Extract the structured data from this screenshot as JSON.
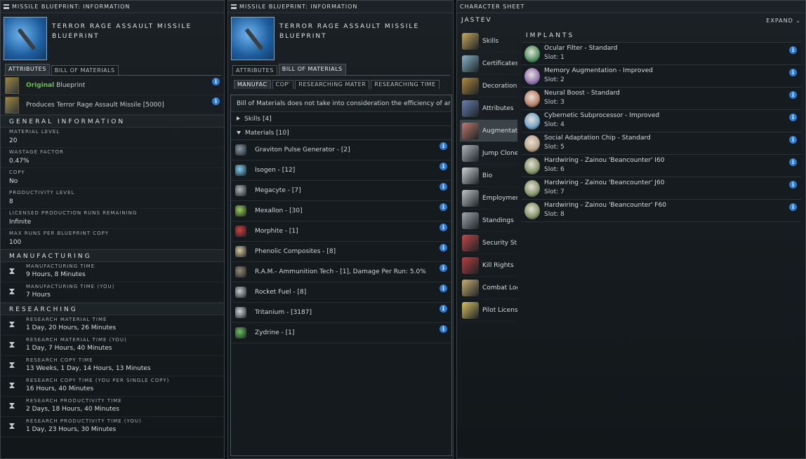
{
  "blueprint_windows": [
    {
      "title": "MISSILE BLUEPRINT: INFORMATION",
      "item_name": "TERROR RAGE ASSAULT MISSILE BLUEPRINT",
      "tabs": [
        "ATTRIBUTES",
        "BILL OF MATERIALS"
      ]
    }
  ],
  "attributes": {
    "original_label": "Original",
    "blueprint_label": "Blueprint",
    "produces": "Produces Terror Rage Assault Missile [5000]",
    "general_header": "GENERAL INFORMATION",
    "general": [
      {
        "k": "MATERIAL LEVEL",
        "v": "20"
      },
      {
        "k": "WASTAGE FACTOR",
        "v": "0.47%"
      },
      {
        "k": "COPY",
        "v": "No"
      },
      {
        "k": "PRODUCTIVITY LEVEL",
        "v": "8"
      },
      {
        "k": "LICENSED PRODUCTION RUNS REMAINING",
        "v": "Infinite"
      },
      {
        "k": "MAX RUNS PER BLUEPRINT COPY",
        "v": "100"
      }
    ],
    "manufacturing_header": "MANUFACTURING",
    "manufacturing": [
      {
        "k": "MANUFACTURING TIME",
        "v": "9 Hours, 8 Minutes"
      },
      {
        "k": "MANUFACTURING TIME (YOU)",
        "v": "7 Hours"
      }
    ],
    "researching_header": "RESEARCHING",
    "researching": [
      {
        "k": "RESEARCH MATERIAL TIME",
        "v": "1 Day, 20 Hours, 26 Minutes"
      },
      {
        "k": "RESEARCH MATERIAL TIME (YOU)",
        "v": "1 Day, 7 Hours, 40 Minutes"
      },
      {
        "k": "RESEARCH COPY TIME",
        "v": "13 Weeks, 1 Day, 14 Hours, 13 Minutes"
      },
      {
        "k": "RESEARCH COPY TIME (YOU PER SINGLE COPY)",
        "v": "16 Hours, 40 Minutes"
      },
      {
        "k": "RESEARCH PRODUCTIVITY TIME",
        "v": "2 Days, 18 Hours, 40 Minutes"
      },
      {
        "k": "RESEARCH PRODUCTIVITY TIME (YOU)",
        "v": "1 Day, 23 Hours, 30 Minutes"
      }
    ]
  },
  "bom": {
    "subtabs": [
      "MANUFAC",
      "COP'",
      "RESEARCHING MATER",
      "RESEARCHING TIME"
    ],
    "notice": "Bill of Materials does not take into consideration the efficiency of ar",
    "skills_label": "Skills [4]",
    "materials_label": "Materials [10]",
    "materials": [
      {
        "name": "Graviton Pulse Generator - [2]",
        "color": "#8a9aa8"
      },
      {
        "name": "Isogen - [12]",
        "color": "#7fd0f0"
      },
      {
        "name": "Megacyte - [7]",
        "color": "#b0b4b8"
      },
      {
        "name": "Mexallon - [30]",
        "color": "#9ccf5a"
      },
      {
        "name": "Morphite - [1]",
        "color": "#d04040"
      },
      {
        "name": "Phenolic Composites - [8]",
        "color": "#d8c8a0"
      },
      {
        "name": "R.A.M.- Ammunition Tech - [1], Damage Per Run: 5.0%",
        "color": "#9a8a78"
      },
      {
        "name": "Rocket Fuel - [8]",
        "color": "#c8ccd0"
      },
      {
        "name": "Tritanium - [3187]",
        "color": "#d0d4d8"
      },
      {
        "name": "Zydrine - [1]",
        "color": "#6cc060"
      }
    ]
  },
  "character": {
    "title": "CHARACTER SHEET",
    "pilot": "JASTEV",
    "expand": "EXPAND",
    "nav": [
      {
        "label": "Skills",
        "color": "#c8a860",
        "icon": "skills-icon"
      },
      {
        "label": "Certificates",
        "color": "#8ab4c8",
        "icon": "certificates-icon"
      },
      {
        "label": "Decorations",
        "color": "#b08a40",
        "icon": "decorations-icon"
      },
      {
        "label": "Attributes",
        "color": "#6a80b0",
        "icon": "attributes-icon"
      },
      {
        "label": "Augmentatio",
        "color": "#c07a70",
        "icon": "augmentations-icon"
      },
      {
        "label": "Jump Clone",
        "color": "#b0b8c0",
        "icon": "jump-clone-icon"
      },
      {
        "label": "Bio",
        "color": "#d0d4d8",
        "icon": "bio-icon"
      },
      {
        "label": "Employment",
        "color": "#c0c4c8",
        "icon": "employment-icon"
      },
      {
        "label": "Standings",
        "color": "#a0a8b0",
        "icon": "standings-icon"
      },
      {
        "label": "Security St",
        "color": "#c04848",
        "icon": "security-status-icon"
      },
      {
        "label": "Kill Rights",
        "color": "#b84040",
        "icon": "kill-rights-icon"
      },
      {
        "label": "Combat Log",
        "color": "#c8b070",
        "icon": "combat-log-icon"
      },
      {
        "label": "Pilot Licens",
        "color": "#d8c060",
        "icon": "pilot-license-icon"
      }
    ],
    "implants_header": "IMPLANTS",
    "implants": [
      {
        "name": "Ocular Filter - Standard",
        "slot": "Slot: 1",
        "color": "#5a9a6a"
      },
      {
        "name": "Memory Augmentation - Improved",
        "slot": "Slot: 2",
        "color": "#9a7ab8"
      },
      {
        "name": "Neural Boost - Standard",
        "slot": "Slot: 3",
        "color": "#c08a70"
      },
      {
        "name": "Cybernetic Subprocessor - Improved",
        "slot": "Slot: 4",
        "color": "#7aa8c8"
      },
      {
        "name": "Social Adaptation Chip - Standard",
        "slot": "Slot: 5",
        "color": "#c0a890"
      },
      {
        "name": "Hardwiring - Zainou 'Beancounter' I60",
        "slot": "Slot: 6",
        "color": "#8a9a70"
      },
      {
        "name": "Hardwiring - Zainou 'Beancounter' J60",
        "slot": "Slot: 7",
        "color": "#8a9a70"
      },
      {
        "name": "Hardwiring - Zainou 'Beancounter' F60",
        "slot": "Slot: 8",
        "color": "#8a9a70"
      }
    ]
  }
}
